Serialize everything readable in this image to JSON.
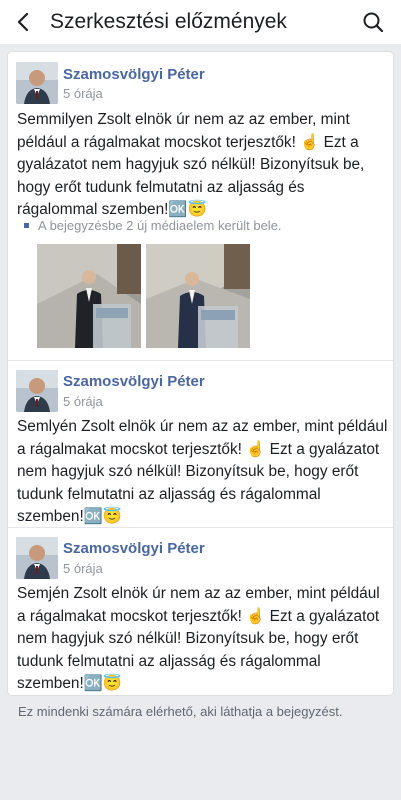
{
  "header": {
    "title": "Szerkesztési előzmények"
  },
  "entries": [
    {
      "author": "Szamosvölgyi Péter",
      "time": "5 órája",
      "text": "Semmilyen Zsolt elnök úr nem az az ember, mint például a rágalmakat mocskot terjesztők! ☝ Ezt a gyalázatot nem hagyjuk szó nélkül! Bizonyítsuk be, hogy erőt tudunk felmutatni az aljasság és rágalommal szemben!🆗😇",
      "media_note": "A bejegyzésbe 2 új médiaelem került bele."
    },
    {
      "author": "Szamosvölgyi Péter",
      "time": "5 órája",
      "text": "Semlyén Zsolt elnök úr nem az az ember, mint például a rágalmakat mocskot terjesztők! ☝ Ezt a gyalázatot nem hagyjuk szó nélkül! Bizonyítsuk be, hogy erőt tudunk felmutatni az aljasság és rágalommal szemben!🆗😇"
    },
    {
      "author": "Szamosvölgyi Péter",
      "time": "5 órája",
      "text": "Semjén Zsolt elnök úr nem az az ember, mint például a rágalmakat mocskot terjesztők! ☝ Ezt a gyalázatot nem hagyjuk szó nélkül! Bizonyítsuk be, hogy erőt tudunk felmutatni az aljasság és rágalommal szemben!🆗😇"
    }
  ],
  "footer": {
    "text": "Ez mindenki számára elérhető, aki láthatja a bejegyzést."
  },
  "colors": {
    "accent": "#4b67a1",
    "background": "#e9ebee",
    "muted": "#90949c"
  },
  "icons": [
    "back-arrow-icon",
    "search-icon"
  ]
}
